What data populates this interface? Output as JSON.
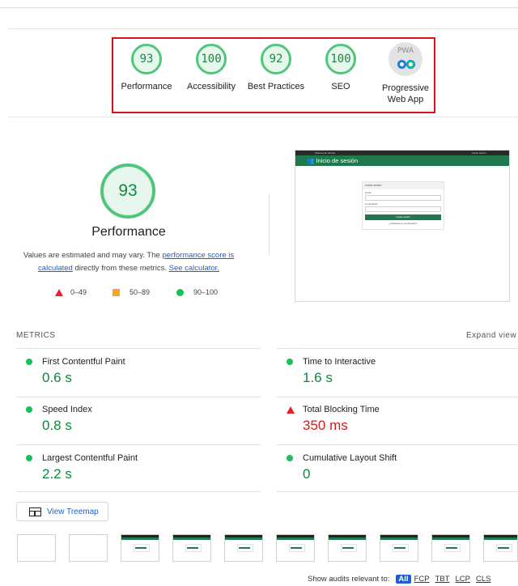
{
  "categories": [
    {
      "score": "93",
      "label": "Performance"
    },
    {
      "score": "100",
      "label": "Accessibility"
    },
    {
      "score": "92",
      "label": "Best Practices"
    },
    {
      "score": "100",
      "label": "SEO"
    }
  ],
  "pwa": {
    "badge": "PWA",
    "label_line1": "Progressive",
    "label_line2": "Web App"
  },
  "performance": {
    "score": "93",
    "title": "Performance",
    "desc_pre": "Values are estimated and may vary. The ",
    "desc_link1": "performance score is calculated",
    "desc_mid": " directly from these metrics. ",
    "desc_link2": "See calculator."
  },
  "legend": {
    "fail": "0–49",
    "average": "50–89",
    "pass": "90–100"
  },
  "screenshot": {
    "topbar_left": "Sistema de Ventas",
    "topbar_right": "Iniciar sesión",
    "header": "Inicio de sesión",
    "card_title": "Iniciar sesión",
    "email_label": "Email",
    "password_label": "Contraseña",
    "button": "Iniciar sesión",
    "link": "¿Olvidaste tu contraseña?"
  },
  "metrics": {
    "heading": "METRICS",
    "expand": "Expand view",
    "items": [
      {
        "label": "First Contentful Paint",
        "value": "0.6 s",
        "status": "pass"
      },
      {
        "label": "Time to Interactive",
        "value": "1.6 s",
        "status": "pass"
      },
      {
        "label": "Speed Index",
        "value": "0.8 s",
        "status": "pass"
      },
      {
        "label": "Total Blocking Time",
        "value": "350 ms",
        "status": "fail"
      },
      {
        "label": "Largest Contentful Paint",
        "value": "2.2 s",
        "status": "pass"
      },
      {
        "label": "Cumulative Layout Shift",
        "value": "0",
        "status": "pass"
      }
    ]
  },
  "treemap": {
    "label": "View Treemap"
  },
  "audits": {
    "prefix": "Show audits relevant to:",
    "all": "All",
    "fcp": "FCP",
    "tbt": "TBT",
    "lcp": "LCP",
    "cls": "CLS"
  },
  "colors": {
    "pass": "#0cce6b",
    "fail": "#ff4e42",
    "average": "#ffa400",
    "link": "#1a5fd6"
  }
}
